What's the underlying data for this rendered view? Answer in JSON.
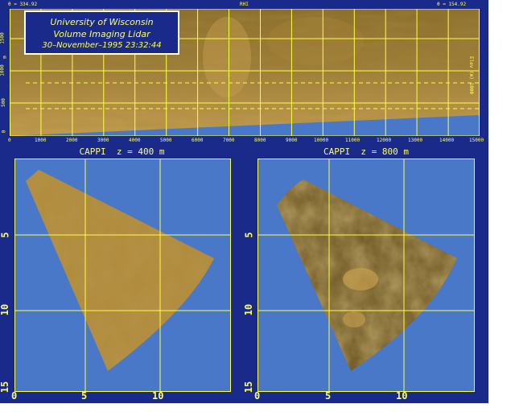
{
  "rhi": {
    "header_left": "θ = 334.92",
    "header_center": "RHI",
    "header_right": "θ = 154.92",
    "y_axis_unit": "m",
    "y_ticks": [
      "0",
      "500",
      "1000",
      "1500"
    ],
    "x_ticks": [
      "0",
      "1000",
      "2000",
      "3000",
      "4000",
      "5000",
      "6000",
      "7000",
      "8000",
      "9000",
      "10000",
      "11000",
      "12000",
      "13000",
      "14000",
      "15000"
    ],
    "right_label": "Elev (m) 1000",
    "title_box": {
      "line1": "University of Wisconsin",
      "line2": "Volume Imaging Lidar",
      "line3": "30–November–1995 23:32:44"
    }
  },
  "cappi_left": {
    "title": "CAPPI  z = 400 m",
    "x_ticks": [
      "0",
      "5",
      "10"
    ],
    "y_ticks": [
      "5",
      "10",
      "15"
    ]
  },
  "cappi_right": {
    "title": "CAPPI  z = 800 m",
    "x_ticks": [
      "0",
      "5",
      "10"
    ],
    "y_ticks": [
      "5",
      "10",
      "15"
    ]
  },
  "colors": {
    "frame": "#1a2a8a",
    "plot_bg": "#4a78c8",
    "grid": "#ffff44",
    "scan_tan": "#b08a3c",
    "scan_dark": "#6a5220",
    "label": "#ffff66"
  }
}
